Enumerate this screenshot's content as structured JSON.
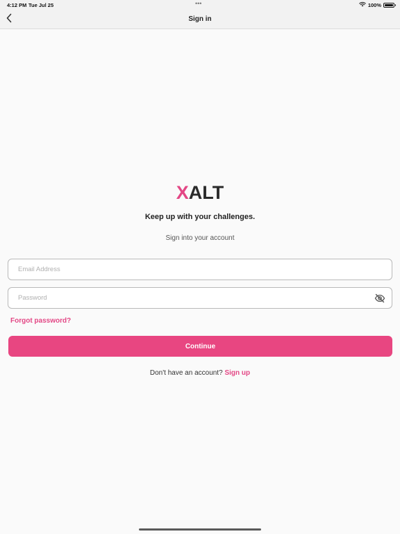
{
  "status_bar": {
    "time": "4:12 PM",
    "date": "Tue Jul 25",
    "dots": "•••",
    "battery": "100%",
    "battery_level": 1.0
  },
  "nav": {
    "title": "Sign in",
    "back_icon": "chevron-left-icon"
  },
  "brand": {
    "logo_accent": "X",
    "logo_rest": "ALT",
    "accent_color": "#e34785",
    "text_color": "#2b2b2b"
  },
  "content": {
    "tagline": "Keep up with your challenges.",
    "subtitle": "Sign into your account"
  },
  "form": {
    "email_placeholder": "Email Address",
    "email_value": "",
    "password_placeholder": "Password",
    "password_value": "",
    "password_toggle_icon": "eye-off-icon",
    "forgot_label": "Forgot password?",
    "continue_label": "Continue",
    "button_color": "#e84681"
  },
  "signup": {
    "prompt": "Don't have an account?",
    "link_label": "Sign up"
  }
}
